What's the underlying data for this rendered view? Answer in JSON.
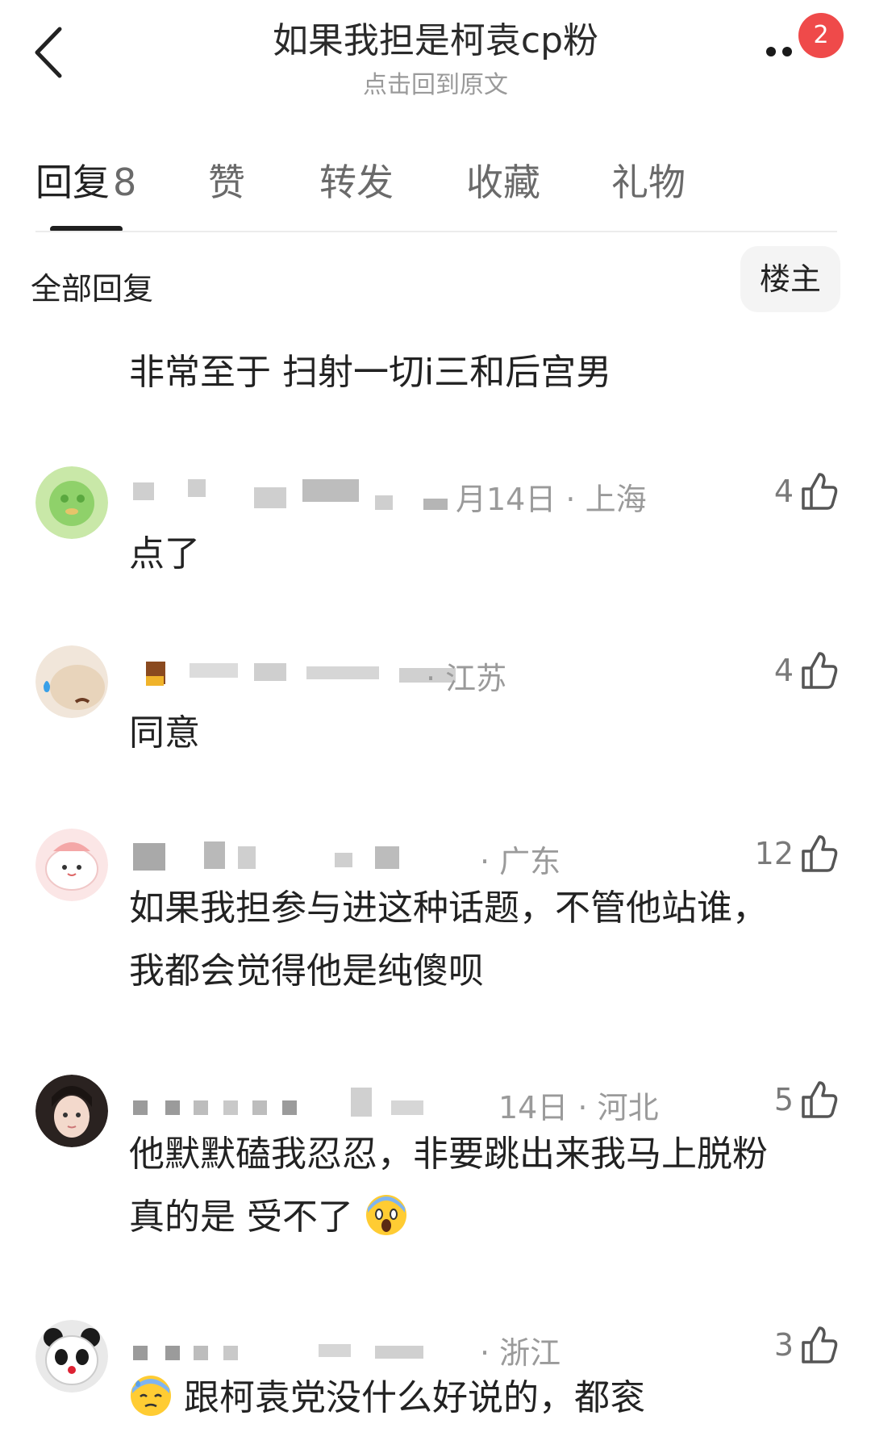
{
  "header": {
    "title": "如果我担是柯袁cp粉",
    "subtitle": "点击回到原文",
    "notification_count": "2"
  },
  "tabs": [
    {
      "label": "回复",
      "count": "8"
    },
    {
      "label": "赞"
    },
    {
      "label": "转发"
    },
    {
      "label": "收藏"
    },
    {
      "label": "礼物"
    }
  ],
  "filter": {
    "label": "全部回复",
    "owner_button": "楼主"
  },
  "top_comment_text": "非常至于  扫射一切i三和后宫男",
  "comments": [
    {
      "meta": "月14日 · 上海",
      "likes": "4",
      "lines": [
        "点了"
      ]
    },
    {
      "meta": "· 江苏",
      "likes": "4",
      "lines": [
        "同意"
      ]
    },
    {
      "meta": "· 广东",
      "likes": "12",
      "lines": [
        "如果我担参与进这种话题，不管他站谁，",
        "我都会觉得他是纯傻呗"
      ]
    },
    {
      "meta": "14日 · 河北",
      "likes": "5",
      "lines": [
        "他默默磕我忍忍，非要跳出来我马上脱粉",
        "真的是 受不了"
      ]
    },
    {
      "meta": "· 浙江",
      "likes": "3",
      "lines": [
        "跟柯袁党没什么好说的，都衮"
      ]
    }
  ],
  "icons": {
    "back": "chevron-left-icon",
    "more": "more-dots-icon",
    "like": "thumbs-up-icon",
    "emoji_scream": "scream-emoji",
    "emoji_sweat": "sweat-emoji"
  },
  "colors": {
    "badge": "#ef4a4a",
    "muted_text": "#9a9a9a"
  }
}
